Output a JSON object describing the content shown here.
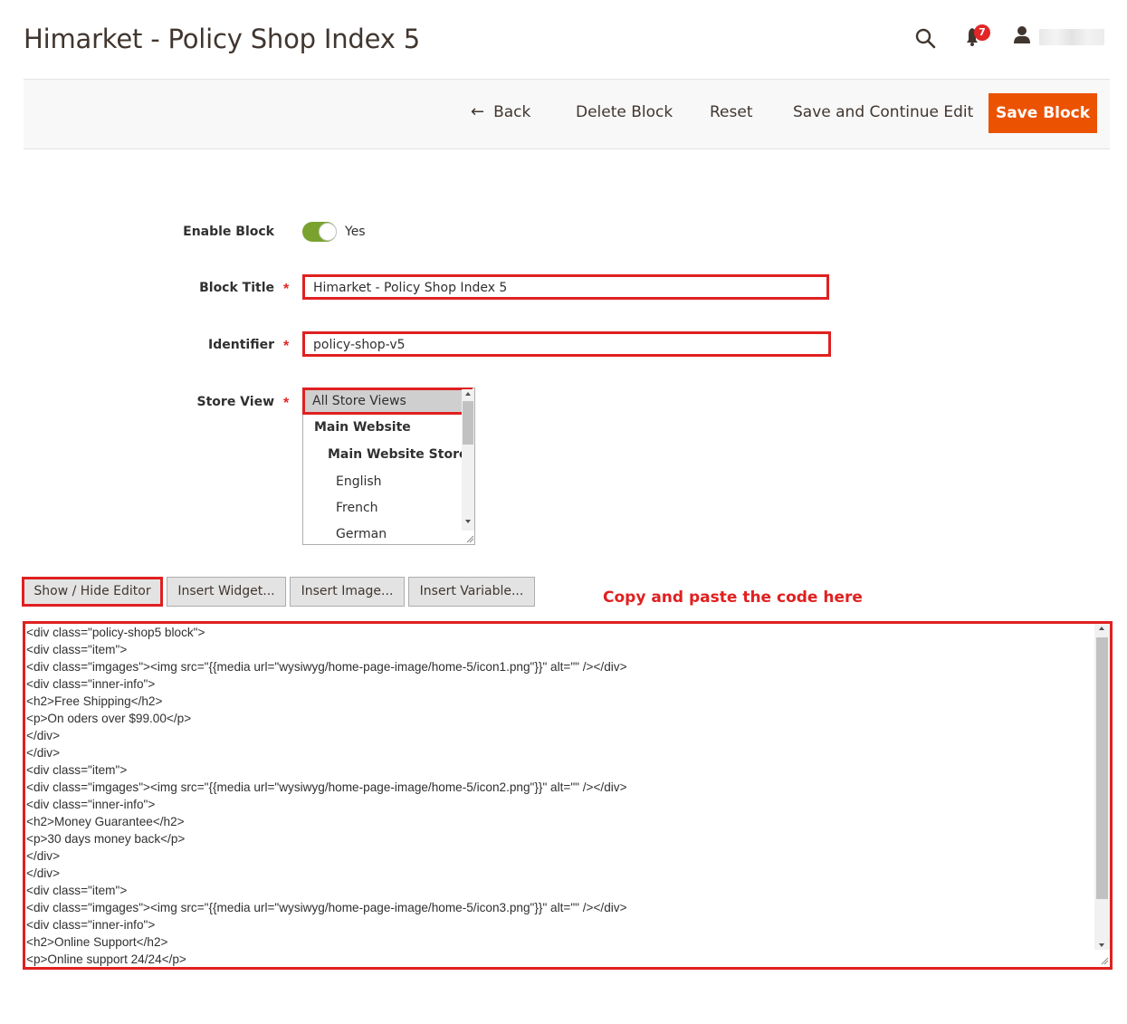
{
  "header": {
    "title": "Himarket - Policy Shop Index 5",
    "notification_count": "7",
    "user_name": ""
  },
  "actions": {
    "back": "Back",
    "delete": "Delete Block",
    "reset": "Reset",
    "save_continue": "Save and Continue Edit",
    "save": "Save Block"
  },
  "form": {
    "enable_label": "Enable Block",
    "enable_value": "Yes",
    "title_label": "Block Title",
    "title_value": "Himarket - Policy Shop Index 5",
    "identifier_label": "Identifier",
    "identifier_value": "policy-shop-v5",
    "store_view_label": "Store View",
    "store_options": [
      "All Store Views",
      "Main Website",
      "Main Website Store",
      "English",
      "French",
      "German"
    ],
    "required_mark": "*"
  },
  "editor": {
    "show_hide": "Show / Hide Editor",
    "insert_widget": "Insert Widget...",
    "insert_image": "Insert Image...",
    "insert_variable": "Insert Variable...",
    "annotation": "Copy and paste the code here",
    "code_lines": [
      "<div class=\"policy-shop5 block\">",
      "<div class=\"item\">",
      "<div class=\"imgages\"><img src=\"{{media url=\"wysiwyg/home-page-image/home-5/icon1.png\"}}\" alt=\"\" /></div>",
      "<div class=\"inner-info\">",
      "<h2>Free Shipping</h2>",
      "<p>On oders over $99.00</p>",
      "</div>",
      "</div>",
      "<div class=\"item\">",
      "<div class=\"imgages\"><img src=\"{{media url=\"wysiwyg/home-page-image/home-5/icon2.png\"}}\" alt=\"\" /></div>",
      "<div class=\"inner-info\">",
      "<h2>Money Guarantee</h2>",
      "<p>30 days money back</p>",
      "</div>",
      "</div>",
      "<div class=\"item\">",
      "<div class=\"imgages\"><img src=\"{{media url=\"wysiwyg/home-page-image/home-5/icon3.png\"}}\" alt=\"\" /></div>",
      "<div class=\"inner-info\">",
      "<h2>Online Support</h2>",
      "<p>Online support 24/24</p>"
    ]
  },
  "colors": {
    "primary_button": "#eb5202",
    "toggle_on": "#79a22e",
    "highlight": "#e02020",
    "badge": "#e22626"
  }
}
